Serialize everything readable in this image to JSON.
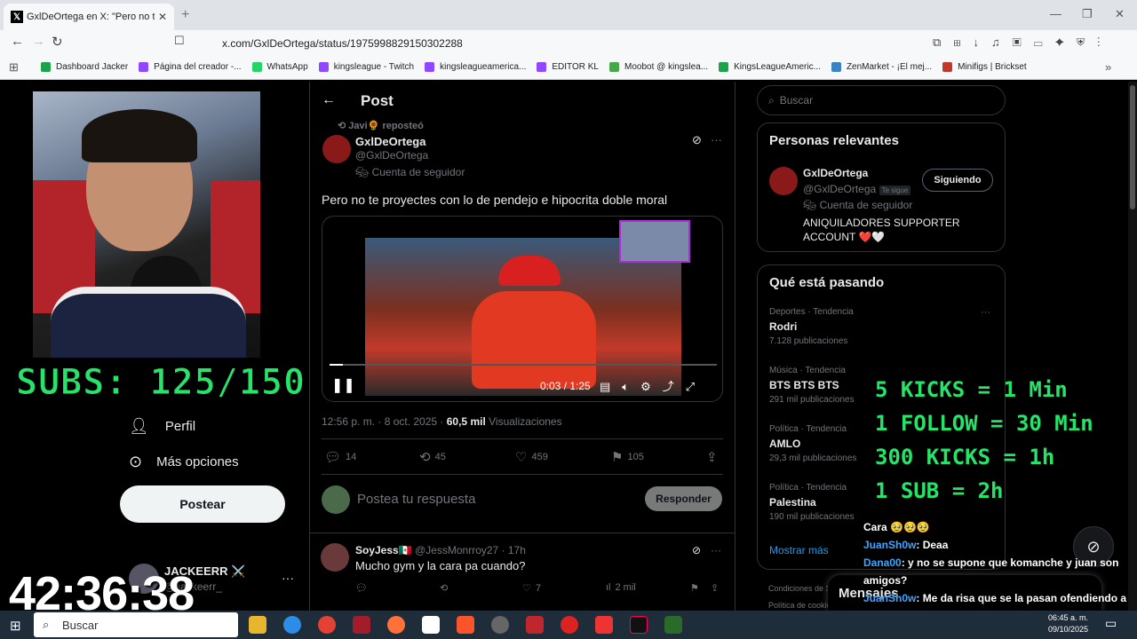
{
  "browser": {
    "tab_title": "GxlDeOrtega en X: \"Pero no t",
    "url": "x.com/GxlDeOrtega/status/1975998829150302288",
    "bookmarks": [
      {
        "label": "Dashboard Jacker",
        "color": "#1aa34a"
      },
      {
        "label": "Página del creador -...",
        "color": "#9146ff"
      },
      {
        "label": "WhatsApp",
        "color": "#25d366"
      },
      {
        "label": "kingsleague - Twitch",
        "color": "#9146ff"
      },
      {
        "label": "kingsleagueamerica...",
        "color": "#9146ff"
      },
      {
        "label": "EDITOR KL",
        "color": "#9146ff"
      },
      {
        "label": "Moobot @ kingslea...",
        "color": "#46a846"
      },
      {
        "label": "KingsLeagueAmeric...",
        "color": "#1aa34a"
      },
      {
        "label": "ZenMarket - ¡El mej...",
        "color": "#3b82c4"
      },
      {
        "label": "Minifigs | Brickset",
        "color": "#c0392b"
      }
    ]
  },
  "left_nav": {
    "items": [
      "Perfil",
      "Más opciones"
    ],
    "post_button": "Postear",
    "account_name": "JACKEERR ⚔️",
    "account_handle": "@Jackeerr_"
  },
  "overlay": {
    "subs": "SUBS: 125/150",
    "timer": "42:36:38",
    "kicks_lines": [
      "5 KICKS = 1 Min",
      "1 FOLLOW = 30 Min",
      "300 KICKS = 1h",
      "1 SUB = 2h"
    ]
  },
  "post": {
    "header": "Post",
    "repost_label": "Javi🌻 reposteó",
    "author_name": "GxlDeOrtega",
    "author_handle": "@GxlDeOrtega",
    "follower_badge": "Cuenta de seguidor",
    "text": "Pero no te proyectes con lo de pendejo e hipocrita doble moral",
    "video_time": "0:03 / 1:25",
    "video_progress": 0.035,
    "timestamp": "12:56 p. m. · 8 oct. 2025 · ",
    "views_count": "60,5 mil",
    "views_label": " Visualizaciones",
    "stats": {
      "replies": "14",
      "reposts": "45",
      "likes": "459",
      "bookmarks": "105"
    },
    "reply_placeholder": "Postea tu respuesta",
    "reply_button": "Responder"
  },
  "reply": {
    "name": "SoyJess🇲🇽",
    "handle": "@JessMonrroy27 · 17h",
    "text": "Mucho gym y la cara pa cuando?",
    "likes": "7",
    "views": "2 mil"
  },
  "sidebar": {
    "search_placeholder": "Buscar",
    "relevant_title": "Personas relevantes",
    "relevant": {
      "name": "GxlDeOrtega",
      "handle": "@GxlDeOrtega",
      "follows_you": "Te sigue",
      "follow_button": "Siguiendo",
      "badge": "Cuenta de seguidor",
      "bio": "ANIQUILADORES SUPPORTER ACCOUNT ❤️🤍"
    },
    "trends_title": "Qué está pasando",
    "trends": [
      {
        "category": "Deportes · Tendencia",
        "name": "Rodri",
        "count": "7.128 publicaciones"
      },
      {
        "category": "Música · Tendencia",
        "name": "BTS BTS BTS",
        "count": "291 mil publicaciones"
      },
      {
        "category": "Política · Tendencia",
        "name": "AMLO",
        "count": "29,3 mil publicaciones"
      },
      {
        "category": "Política · Tendencia",
        "name": "Palestina",
        "count": "190 mil publicaciones"
      }
    ],
    "show_more": "Mostrar más",
    "footer": [
      "Condiciones de S",
      "Política de cookie"
    ],
    "messages": "Mensajes"
  },
  "chat": [
    {
      "user": "",
      "text": "Cara 🥹🥹🥹"
    },
    {
      "user": "JuanSh0w",
      "text": ": Deaa"
    },
    {
      "user": "Dana00",
      "text": ": y no se supone que komanche y juan son amigos?"
    },
    {
      "user": "JuanSh0w",
      "text": ": Me da risa que se la pasan ofendiendo a los creadores Miles de personas, pero si el creador dice algo lo funan xd"
    }
  ],
  "taskbar": {
    "search": "Buscar",
    "time": "06:45 a. m.",
    "date": "09/10/2025"
  }
}
